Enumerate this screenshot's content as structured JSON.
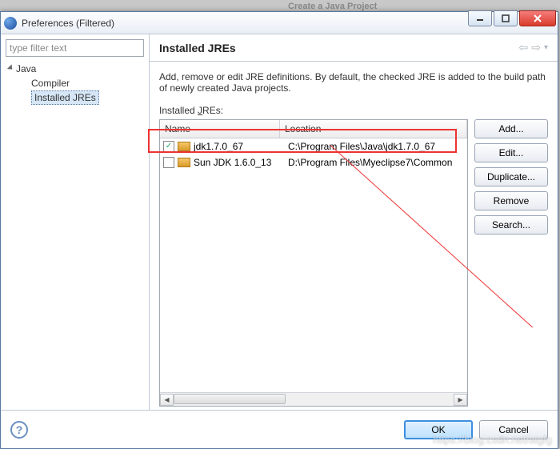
{
  "background_hint": "Create a Java Project",
  "title": "Preferences (Filtered)",
  "filter_placeholder": "type filter text",
  "tree": {
    "root": "Java",
    "child1": "Compiler",
    "child2": "Installed JREs"
  },
  "header": "Installed JREs",
  "description": "Add, remove or edit JRE definitions. By default, the checked JRE is added to the build path of newly created Java projects.",
  "list_label_pre": "Installed ",
  "list_label_u": "J",
  "list_label_post": "REs:",
  "cols": {
    "name": "Name",
    "location": "Location"
  },
  "rows": [
    {
      "checked": true,
      "name": "jdk1.7.0_67",
      "location": "C:\\Program Files\\Java\\jdk1.7.0_67"
    },
    {
      "checked": false,
      "name": "Sun JDK 1.6.0_13",
      "location": "D:\\Program Files\\Myeclipse7\\Common"
    }
  ],
  "buttons": {
    "add": "Add...",
    "edit": "Edit...",
    "dup": "Duplicate...",
    "remove": "Remove",
    "search": "Search..."
  },
  "footer": {
    "ok": "OK",
    "cancel": "Cancel"
  },
  "watermark": "https://blog.csdn.net/atgfg"
}
